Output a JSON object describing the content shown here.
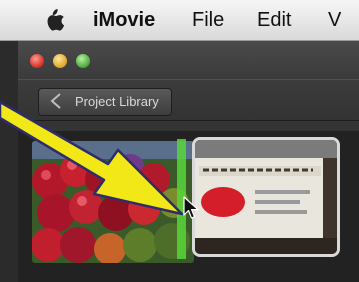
{
  "menubar": {
    "app_name": "iMovie",
    "file": "File",
    "edit": "Edit",
    "more": "V",
    "apple_icon": "apple-logo-icon"
  },
  "window": {
    "back_button_label": "Project Library"
  },
  "annotation": {
    "arrow_color": "#f2e818",
    "arrow_outline": "#2d2d6e",
    "insert_line_color": "#58d63a"
  }
}
